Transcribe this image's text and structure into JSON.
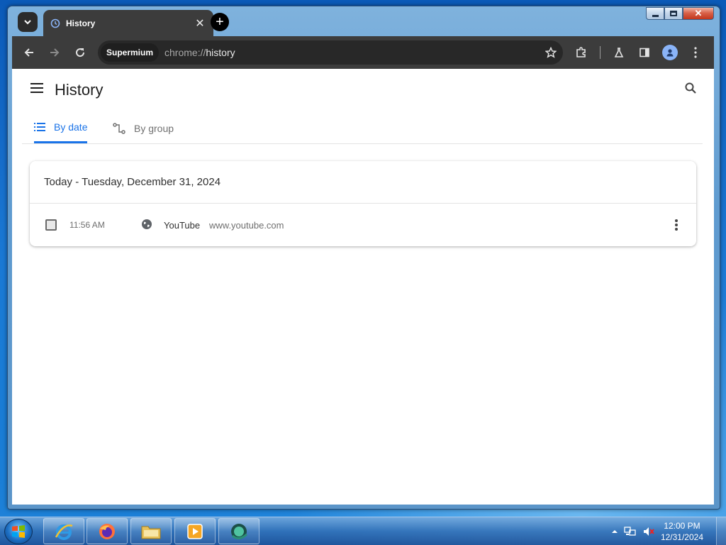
{
  "browser": {
    "tab_title": "History",
    "new_tab_label": "+",
    "site_chip": "Supermium",
    "url_scheme": "chrome://",
    "url_path": "history"
  },
  "page": {
    "title": "History",
    "tabs": [
      {
        "label": "By date",
        "active": true
      },
      {
        "label": "By group",
        "active": false
      }
    ],
    "day_header": "Today - Tuesday, December 31, 2024",
    "entries": [
      {
        "time": "11:56 AM",
        "title": "YouTube",
        "domain": "www.youtube.com"
      }
    ]
  },
  "taskbar": {
    "apps": [
      "internet-explorer",
      "firefox",
      "file-explorer",
      "media-player",
      "supermium"
    ],
    "clock_time": "12:00 PM",
    "clock_date": "12/31/2024"
  },
  "colors": {
    "accent": "#1a73e8",
    "toolbar_bg": "#3c3c3c",
    "page_bg": "#ffffff"
  }
}
